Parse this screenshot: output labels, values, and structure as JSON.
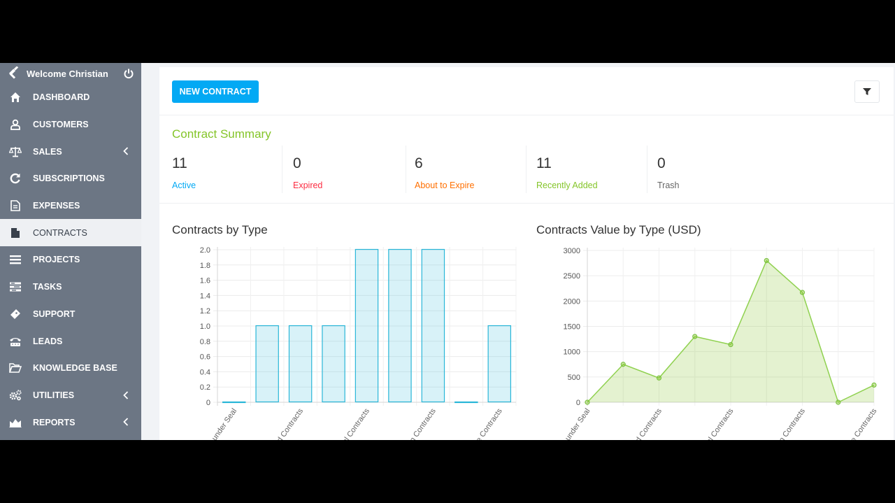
{
  "sidebar": {
    "welcome": "Welcome Christian",
    "items": [
      {
        "label": "DASHBOARD",
        "icon": "home-icon"
      },
      {
        "label": "CUSTOMERS",
        "icon": "user-icon"
      },
      {
        "label": "SALES",
        "icon": "balance-scale-icon"
      },
      {
        "label": "SUBSCRIPTIONS",
        "icon": "refresh-icon"
      },
      {
        "label": "EXPENSES",
        "icon": "file-text-icon"
      },
      {
        "label": "CONTRACTS",
        "icon": "file-icon"
      },
      {
        "label": "PROJECTS",
        "icon": "bars-icon"
      },
      {
        "label": "TASKS",
        "icon": "tasks-icon"
      },
      {
        "label": "SUPPORT",
        "icon": "ticket-icon"
      },
      {
        "label": "LEADS",
        "icon": "tty-icon"
      },
      {
        "label": "KNOWLEDGE BASE",
        "icon": "folder-open-icon"
      },
      {
        "label": "UTILITIES",
        "icon": "cogs-icon"
      },
      {
        "label": "REPORTS",
        "icon": "area-chart-icon"
      }
    ],
    "active": "CONTRACTS"
  },
  "toolbar": {
    "new_contract_label": "NEW CONTRACT"
  },
  "summary": {
    "title": "Contract Summary",
    "stats": [
      {
        "value": "11",
        "label": "Active",
        "color": "#03a9f4"
      },
      {
        "value": "0",
        "label": "Expired",
        "color": "#fc2d42"
      },
      {
        "value": "6",
        "label": "About to Expire",
        "color": "#ff6f00"
      },
      {
        "value": "11",
        "label": "Recently Added",
        "color": "#84c529"
      },
      {
        "value": "0",
        "label": "Trash",
        "color": "#666666"
      }
    ]
  },
  "charts": {
    "by_type_title": "Contracts by Type",
    "value_title": "Contracts Value by Type (USD)"
  },
  "chart_data": [
    {
      "type": "bar",
      "title": "Contracts by Type",
      "categories_visible": [
        "s under Seal",
        "ed Contracts",
        "al Contracts",
        "n Contracts",
        "le Contracts"
      ],
      "values": [
        0,
        1,
        1,
        1,
        2,
        2,
        2,
        0,
        1
      ],
      "ylim": [
        0,
        2.0
      ],
      "yticks": [
        "2.0",
        "1.8",
        "1.6",
        "1.4",
        "1.2",
        "1.0",
        "0.8",
        "0.6",
        "0.4",
        "0.2",
        "0"
      ],
      "grid": true,
      "color": "#29b6d8"
    },
    {
      "type": "area",
      "title": "Contracts Value by Type (USD)",
      "categories_visible": [
        "s under Seal",
        "ed Contracts",
        "al Contracts",
        "n Contracts",
        "le Contracts"
      ],
      "values": [
        0,
        750,
        480,
        1300,
        1140,
        2800,
        2170,
        0,
        340
      ],
      "ylim": [
        0,
        3000
      ],
      "yticks": [
        "3000",
        "2500",
        "2000",
        "1500",
        "1000",
        "500",
        "0"
      ],
      "grid": true,
      "color": "#84c529"
    }
  ]
}
